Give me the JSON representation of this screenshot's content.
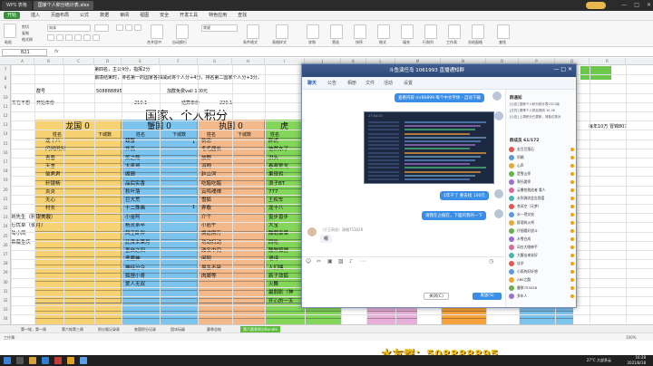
{
  "window": {
    "tabs": [
      "WPS 表格",
      "国家个人积分统计表.xlsx"
    ],
    "active_tab": 1
  },
  "menu": [
    "开始",
    "插入",
    "页面布局",
    "公式",
    "数据",
    "审阅",
    "视图",
    "安全",
    "开发工具",
    "特色应用",
    "查找"
  ],
  "ribbon_labels": [
    "粘贴",
    "剪切",
    "复制",
    "格式刷",
    "宋体",
    "合并居中",
    "自动换行",
    "常规",
    "条件格式",
    "表格样式",
    "求和",
    "筛选",
    "排序",
    "格式",
    "填充",
    "行和列",
    "工作表",
    "冻结窗格",
    "查找"
  ],
  "formula": {
    "cell": "B21",
    "fx": "fx"
  },
  "columns": [
    "A",
    "B",
    "C",
    "D",
    "E",
    "F",
    "G",
    "H",
    "I",
    "J",
    "K",
    "L",
    "M",
    "N",
    "O",
    "P",
    "Q",
    "R"
  ],
  "rows": [
    "7",
    "8",
    "9",
    "10",
    "11",
    "12",
    "13",
    "14",
    "15",
    "16",
    "17",
    "18",
    "19",
    "20",
    "21",
    "22",
    "23",
    "24",
    "25",
    "26",
    "27",
    "28",
    "29",
    "30",
    "31",
    "32",
    "33",
    "34"
  ],
  "sheet_info": {
    "line1": "第四名，主公4分，指挥2分",
    "line2": "霸境结束时，排名第一的国家各抽减武将个人分+4分，排名第二国家个人分+3分。",
    "group_label": "群号",
    "group_no": "508888895",
    "bonus_label": "加群免费vall 100元",
    "left_a": "实在不想",
    "left_b": "开始年份",
    "val1": "210.1",
    "settle_label": "结算年份",
    "val2": "220.1",
    "big_title": "国家、个人积分",
    "right_note": "每年10万 冒锦807"
  },
  "nations": [
    {
      "name": "龙国",
      "score": "0",
      "col_name": "姓名",
      "col_count": "下城数",
      "members": [
        "龙十八",
        "闪闲闲闲",
        "青春",
        "天言",
        "邹君君",
        "轩银杨",
        "炎炎",
        "无心",
        "村长",
        "刘先生（轩银美酸）",
        "忘忧草（夜月）",
        "陆小凤",
        "希薇生庆"
      ]
    },
    {
      "name": "蟹国",
      "score": "0",
      "col_name": "姓名",
      "col_count": "下城数",
      "members": [
        "螃蟹",
        "拌瓦",
        "笑之殇",
        "太表哥",
        "阁珊",
        "品后实香",
        "秋叶落",
        "巨大荒",
        "十二殊画",
        "小金阿",
        "杨灵茶卒",
        "风王卧伴",
        "此夜未果月",
        "墨白之间",
        "恶魔神",
        "神经分今",
        "狐狸小哥",
        "爱人无双"
      ]
    },
    {
      "name": "执国",
      "score": "0",
      "col_name": "姓名",
      "col_count": "下城数",
      "members": [
        "执念",
        "毛毛届长",
        "放野",
        "羽翰",
        "赵山河",
        "吃醋吃醋",
        "云鸣魂禅",
        "雪狐",
        "弄歌",
        "介个",
        "小岩午",
        "换途刚万",
        "功动扫动",
        "改名中究",
        "闲阿",
        "最生不染",
        "肉脚等"
      ]
    },
    {
      "name": "虎",
      "score": "",
      "col_name": "姓名",
      "col_count": "",
      "members": [
        "胖虎",
        "信然水了",
        "洪头",
        "春寒繁龙",
        "果母鸡",
        "浪子BT",
        "777",
        "王权车",
        "龙十八",
        "曾步曾步",
        "大宝",
        "酣暇枭菜",
        "同吃",
        "酸熟狐狸",
        "语诗",
        "人们嘿",
        "疯子敛狐",
        "火舞",
        "最弱影（神",
        "开心的一天",
        "多谋咸"
      ]
    }
  ],
  "counts": {
    "r1": "1",
    "r2": "1"
  },
  "sheets": [
    "第一轮，第一周",
    "第六轮第三周",
    "积分版记录表",
    "各国积分记录",
    "团冰玩级",
    "赛季总结",
    "第六赛季积分Bundle"
  ],
  "active_sheet": 6,
  "status": {
    "left": "工作簿 ·",
    "right": "100%"
  },
  "qq": {
    "title": "斗鱼演任岛 1061993 直播通知群",
    "tabs": [
      "聊天",
      "公告",
      "相册",
      "文件",
      "活动",
      "设置"
    ],
    "messages": [
      {
        "side": "right",
        "text": "查看内容 mr86899 每个中文字体 - 自动下载"
      },
      {
        "side": "right",
        "text": "1年千了 要去找 100元"
      },
      {
        "side": "right",
        "text": "请我在占据在，下面的我的一下"
      }
    ],
    "shot_stamp": "17:04:23",
    "left_sender": "（于王同花）演唱753026",
    "left_msg": "嗯",
    "close_btn": "关闭(C)",
    "send_btn": "发送(S)",
    "side_heading": "群通知",
    "announcements": [
      "[公告] 国家个人积分统计表2021版",
      "[文件] 赛季个人排名规则 10.3K",
      "[公告] 上周积分已更新，请各位核对"
    ],
    "member_heading": "群成员 61/172",
    "members": [
      "金豆豆落石",
      "阿娟",
      "心声",
      "是雪山师",
      "寄托要师",
      "云撒拍挑战者 看人",
      "水到源尚会告我爱",
      "苍风空（天梦）",
      "水一把文枝",
      "醉酒的火鸡",
      "仔细要好战斗",
      "水雪白成",
      "风在大眼神手",
      "大醒出来说好",
      "佳学",
      "小雨的好好想",
      "ΛBS之酷",
      "曼联753026",
      "多年人"
    ]
  },
  "promo": "水友群：508888895",
  "taskbar": {
    "weather": "27°C 大部多云",
    "time": "16:28",
    "date": "2021/8/18"
  },
  "colors": {
    "dragon": "#f6d272",
    "crab": "#7cc3ee",
    "cast": "#f4b98a",
    "tiger": "#83d65a",
    "pink": "#e8b0d8",
    "orange": "#f6a23c",
    "qq_blue": "#3a8ee6"
  }
}
